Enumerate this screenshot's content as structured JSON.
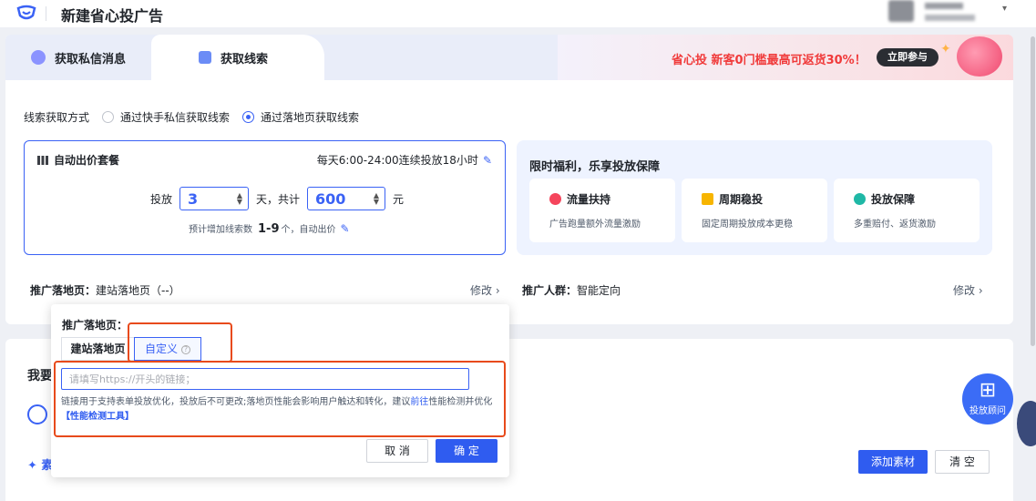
{
  "header": {
    "title": "新建省心投广告"
  },
  "tabs": [
    {
      "label": "获取私信消息"
    },
    {
      "label": "获取线索"
    }
  ],
  "promo": {
    "text": "省心投 新客0门槛最高可返货30%！",
    "button": "立即参与"
  },
  "lead_method": {
    "label": "线索获取方式",
    "options": [
      {
        "label": "通过快手私信获取线索",
        "selected": false
      },
      {
        "label": "通过落地页获取线索",
        "selected": true
      }
    ]
  },
  "budget": {
    "title": "自动出价套餐",
    "schedule": "每天6:00-24:00连续投放18小时",
    "prefix": "投放",
    "days": "3",
    "unit_days": "天，共计",
    "amount": "600",
    "unit_money": "元",
    "hint_prefix": "预计增加线索数",
    "hint_value": "1-9",
    "hint_suffix": "个，自动出价"
  },
  "perks": {
    "title": "限时福利，乐享投放保障",
    "items": [
      {
        "name": "流量扶持",
        "desc": "广告跑量额外流量激励",
        "color": "#f5455c"
      },
      {
        "name": "周期稳投",
        "desc": "固定周期投放成本更稳",
        "color": "#f7b500"
      },
      {
        "name": "投放保障",
        "desc": "多重赔付、返货激励",
        "color": "#1fb8a6"
      }
    ]
  },
  "landing": {
    "label": "推广落地页：",
    "value": "建站落地页（--）",
    "modify": "修改 ›"
  },
  "audience": {
    "label": "推广人群：",
    "value": "智能定向",
    "modify": "修改 ›"
  },
  "card2": {
    "title": "我要",
    "spark": "✦ 素",
    "add_button": "添加素材",
    "clear_button": "清 空"
  },
  "popover": {
    "title": "推广落地页：",
    "seg_built": "建站落地页",
    "seg_custom": "自定义",
    "input_placeholder": "请填写https://开头的链接；",
    "hint_main": "链接用于支持表单投放优化，投放后不可更改;落地页性能会影响用户触达和转化，建议",
    "hint_go": "前往",
    "hint_mid": "性能检测并优化",
    "hint_tool": "【性能检测工具】",
    "cancel": "取 消",
    "ok": "确 定"
  },
  "consult": {
    "label": "投放顾问"
  },
  "colors": {
    "primary": "#2f5cf0",
    "highlight": "#e84a1b",
    "promo_red": "#f03a3a"
  }
}
